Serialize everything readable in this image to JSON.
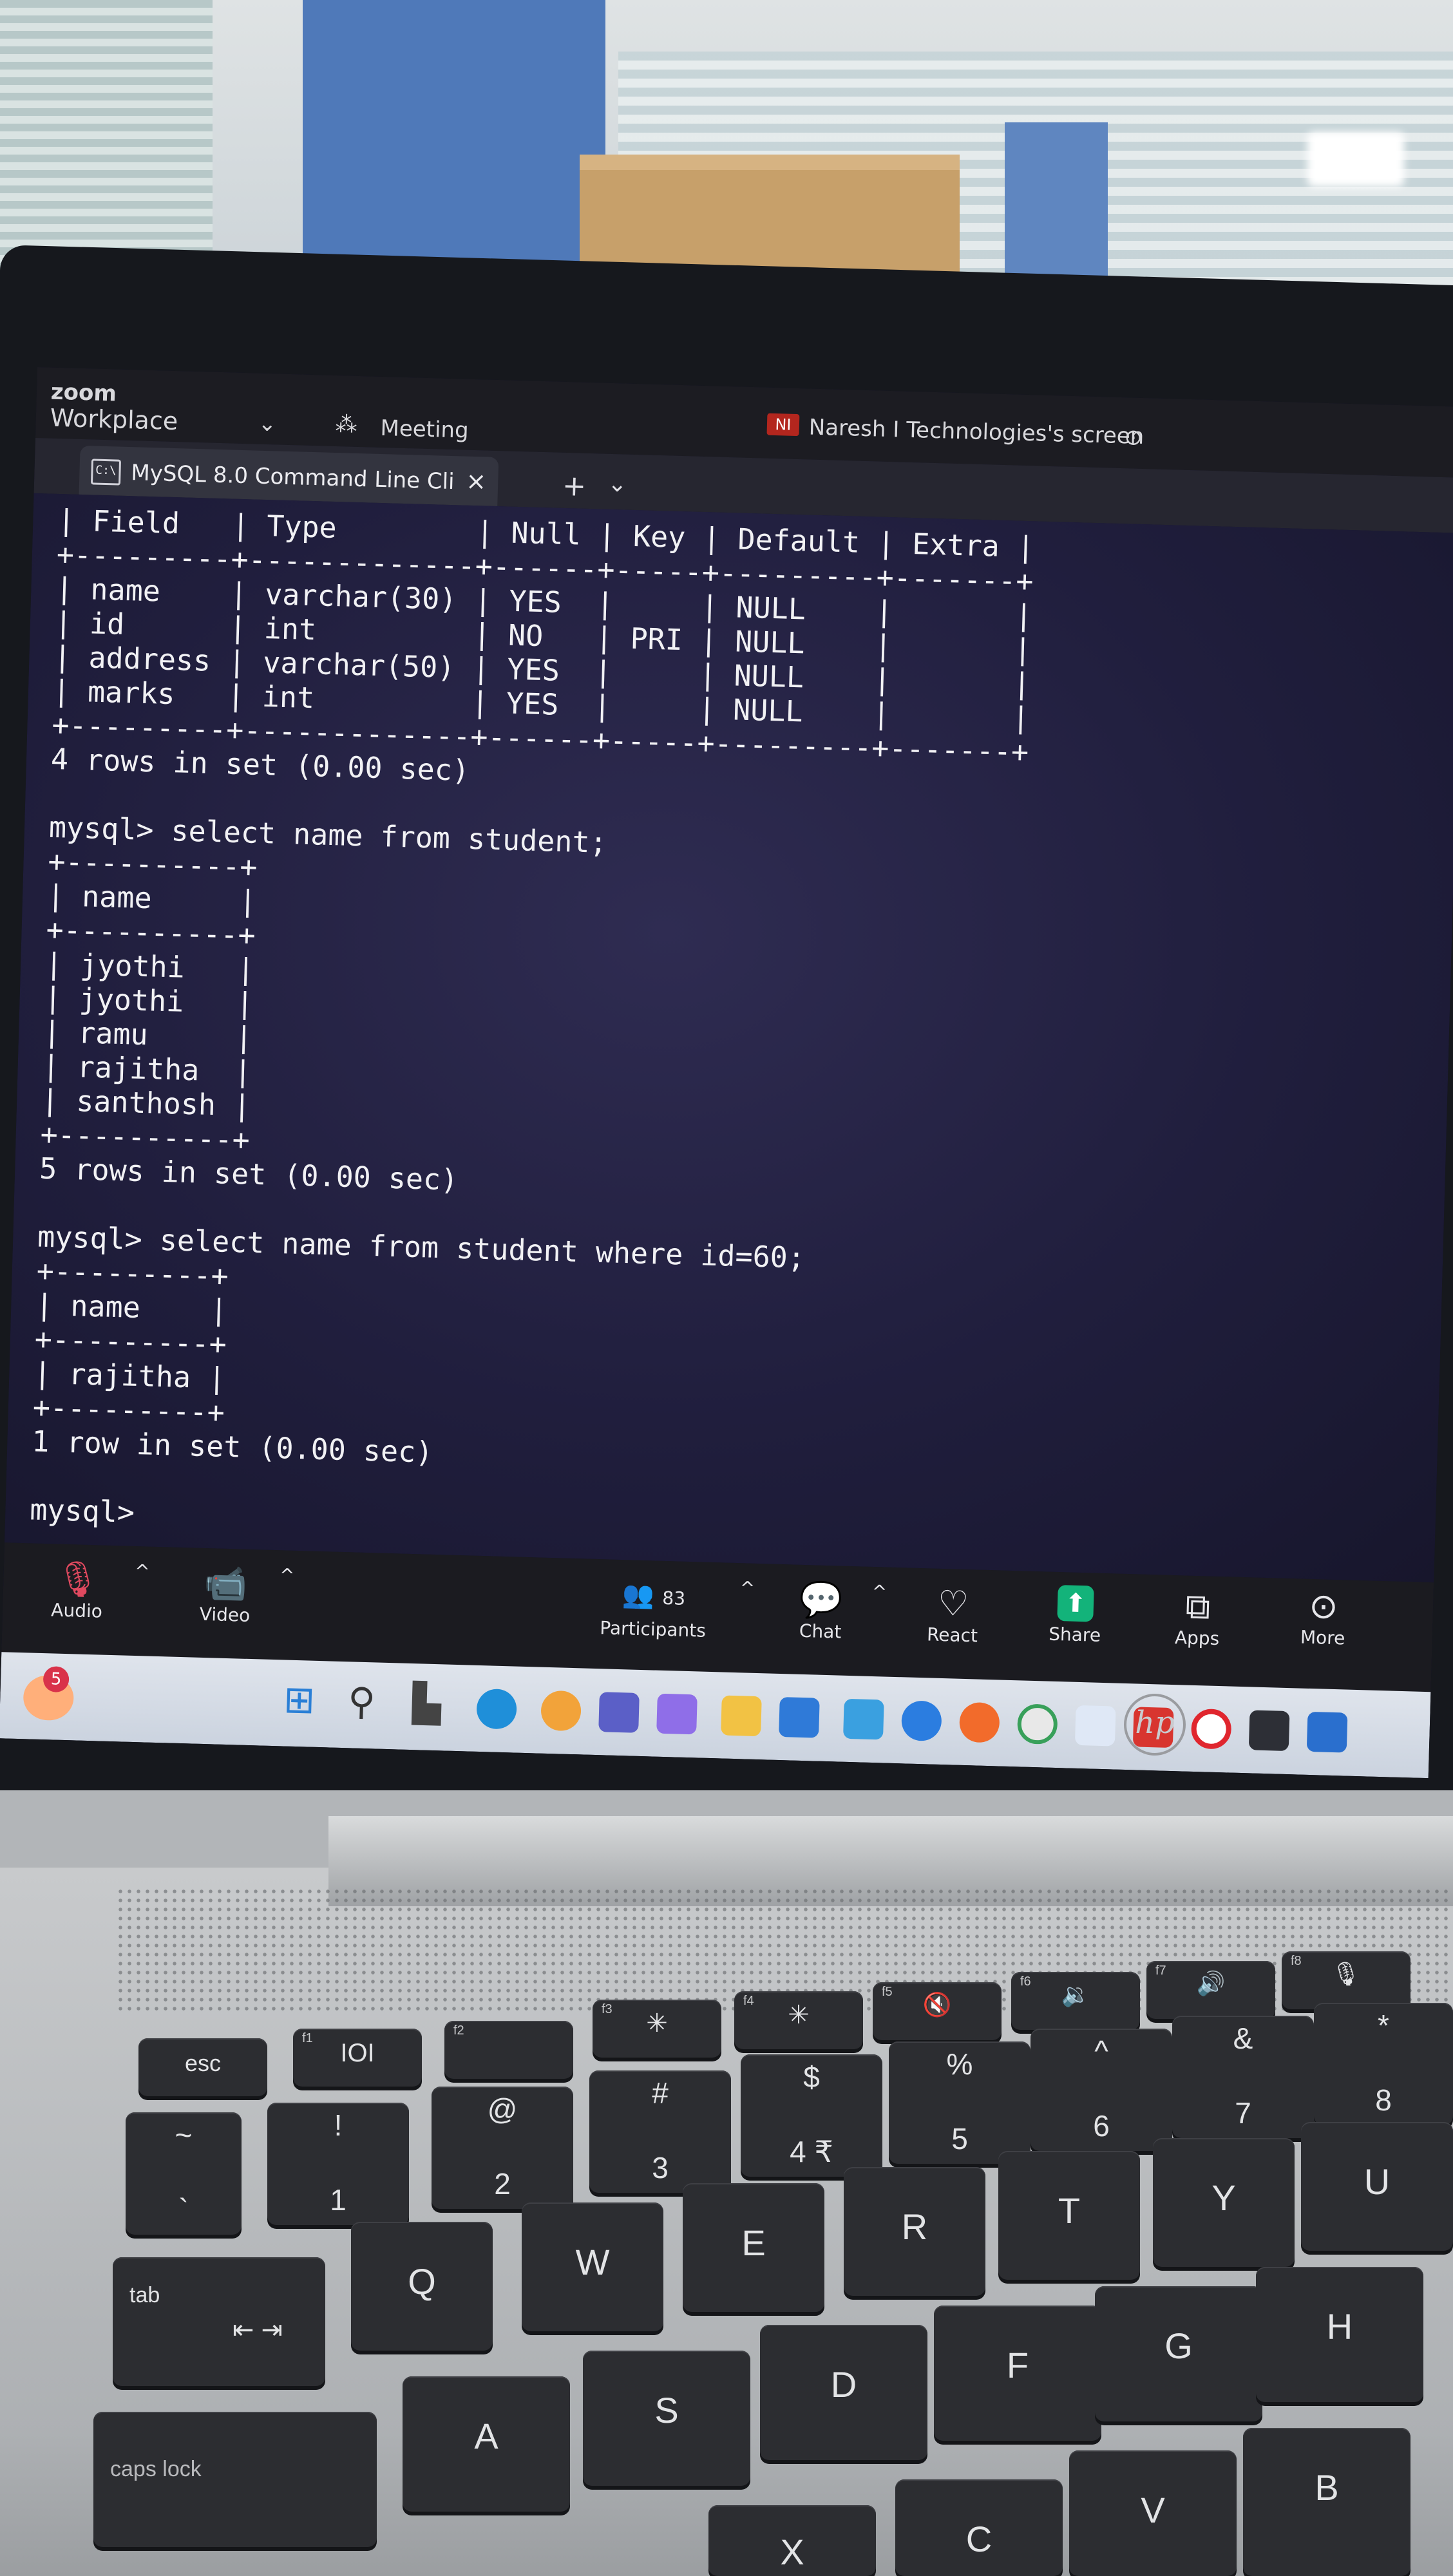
{
  "zoom": {
    "brand": "zoom",
    "workplace": "Workplace",
    "meeting": "Meeting",
    "presenter_initials": "NI",
    "screen_share_label": "Naresh I Technologies's screen"
  },
  "terminal_tab": {
    "title": "MySQL 8.0 Command Line Cli",
    "icon_text": "C:\\",
    "close": "×",
    "new_tab": "+",
    "dropdown": "⌄"
  },
  "console_lines": [
    "| Field   | Type        | Null | Key | Default | Extra |",
    "+---------+-------------+------+-----+---------+-------+",
    "| name    | varchar(30) | YES  |     | NULL    |       |",
    "| id      | int         | NO   | PRI | NULL    |       |",
    "| address | varchar(50) | YES  |     | NULL    |       |",
    "| marks   | int         | YES  |     | NULL    |       |",
    "+---------+-------------+------+-----+---------+-------+",
    "4 rows in set (0.00 sec)",
    "",
    "mysql> select name from student;",
    "+----------+",
    "| name     |",
    "+----------+",
    "| jyothi   |",
    "| jyothi   |",
    "| ramu     |",
    "| rajitha  |",
    "| santhosh |",
    "+----------+",
    "5 rows in set (0.00 sec)",
    "",
    "mysql> select name from student where id=60;",
    "+---------+",
    "| name    |",
    "+---------+",
    "| rajitha |",
    "+---------+",
    "1 row in set (0.00 sec)",
    "",
    "mysql>"
  ],
  "zoom_bar": {
    "audio": "Audio",
    "video": "Video",
    "participants": "Participants",
    "participant_count": "83",
    "chat": "Chat",
    "react": "React",
    "share": "Share",
    "apps": "Apps",
    "more": "More",
    "caret": "^"
  },
  "taskbar": {
    "notification_count": "5",
    "icons": [
      "windows-start-icon",
      "search-icon",
      "task-view-icon",
      "edge-icon",
      "copilot-icon",
      "teams-icon",
      "widgets-icon",
      "file-explorer-icon",
      "store-icon",
      "mobile-app-icon",
      "vpn-icon",
      "firefox-icon",
      "chrome-icon",
      "paint-icon",
      "wps-icon",
      "opera-icon",
      "terminal-icon",
      "excel-icon"
    ]
  },
  "laptop_brand": "hp",
  "keyboard": {
    "row_fn": [
      {
        "label": "esc"
      },
      {
        "label": "IOI",
        "fn": "f1"
      },
      {
        "label": "",
        "fn": "f2"
      },
      {
        "label": "✳",
        "fn": "f3"
      },
      {
        "label": "✳",
        "fn": "f4"
      },
      {
        "label": "🔇",
        "fn": "f5"
      },
      {
        "label": "🔉",
        "fn": "f6"
      },
      {
        "label": "🔊",
        "fn": "f7"
      },
      {
        "label": "🎙",
        "fn": "f8"
      }
    ],
    "row_num": [
      {
        "top": "~",
        "bottom": "`"
      },
      {
        "top": "!",
        "bottom": "1"
      },
      {
        "top": "@",
        "bottom": "2"
      },
      {
        "top": "#",
        "bottom": "3"
      },
      {
        "top": "$",
        "bottom": "4 ₹"
      },
      {
        "top": "%",
        "bottom": "5"
      },
      {
        "top": "^",
        "bottom": "6"
      },
      {
        "top": "&",
        "bottom": "7"
      },
      {
        "top": "*",
        "bottom": "8"
      }
    ],
    "row_q": [
      {
        "label": "tab",
        "sub": "⇤ ⇥"
      },
      {
        "label": "Q"
      },
      {
        "label": "W"
      },
      {
        "label": "E"
      },
      {
        "label": "R"
      },
      {
        "label": "T"
      },
      {
        "label": "Y"
      },
      {
        "label": "U"
      }
    ],
    "row_a": [
      {
        "label": "caps lock"
      },
      {
        "label": "A"
      },
      {
        "label": "S"
      },
      {
        "label": "D"
      },
      {
        "label": "F"
      },
      {
        "label": "G"
      },
      {
        "label": "H"
      }
    ],
    "row_z": [
      {
        "label": "X"
      },
      {
        "label": "C"
      },
      {
        "label": "V"
      },
      {
        "label": "B"
      }
    ]
  },
  "colors": {
    "console_bg": "#201e3d",
    "console_text": "#f1f1f4",
    "zoom_bar_bg": "#1b1b20",
    "share_green": "#13b37a",
    "mute_red": "#e0495f",
    "key_bg": "#2c2d31"
  }
}
